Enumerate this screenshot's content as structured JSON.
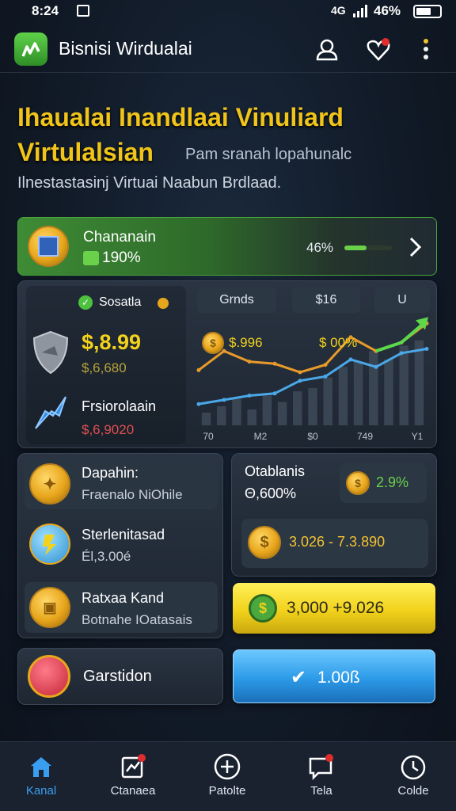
{
  "status_bar": {
    "time": "8:24",
    "battery": "46%"
  },
  "header": {
    "title": "Bisnisi Wirdualai"
  },
  "hero": {
    "line1": "Ihaualai Inandlaai Vinuliard",
    "line2": "Virtulalsian",
    "line2_sub": "Pam sranah lopahunalc",
    "line3": "Ilnestastasinj Virtuai Naabun Brdlaad."
  },
  "banner": {
    "title": "Chananain",
    "rate": "190%",
    "percent": "46%",
    "progress": 0.46
  },
  "stats_card": {
    "badge": "Sosatla",
    "value_main": "$,8.99",
    "value_sub": "$,6,680",
    "item_label": "Frsiorolaain",
    "item_value": "$,6,9020"
  },
  "chart_header": {
    "tab_1": "Grnds",
    "tab_2": "$16",
    "tab_3": "U"
  },
  "chart_labels": {
    "label_1": "$.996",
    "label_2": "$ 00%"
  },
  "chart_data": {
    "type": "line",
    "x_ticks": [
      "70",
      "M2",
      "$0",
      "749",
      "Y1"
    ],
    "series": [
      {
        "values": [
          52,
          70,
          60,
          58,
          50,
          57,
          83,
          70,
          78,
          96
        ]
      },
      {
        "values": [
          20,
          24,
          28,
          30,
          42,
          46,
          62,
          55,
          68,
          72
        ]
      }
    ],
    "bars": [
      12,
      18,
      25,
      15,
      28,
      22,
      32,
      35,
      45,
      55,
      60,
      70,
      62,
      75,
      80
    ],
    "ylim": [
      0,
      100
    ]
  },
  "left_list": [
    {
      "title": "Dapahin:",
      "subtitle": "Fraenalo NiOhile"
    },
    {
      "title": "Sterlenitasad",
      "subtitle": "Él,3.00é"
    },
    {
      "title": "Ratxaa Kand",
      "subtitle": "Botnahe IOatasais"
    }
  ],
  "right_card": {
    "title": "Otablanis",
    "value": "Θ,600%",
    "rate": "2.9%"
  },
  "gold_row": {
    "text": "3.026 - 7.3.890"
  },
  "yellow_button": {
    "label": "3,000 +9.026"
  },
  "bottom_left": {
    "label": "Garstidon"
  },
  "blue_button": {
    "label": "1.00ß"
  },
  "bottom_nav": [
    {
      "label": "Kanal"
    },
    {
      "label": "Ctanaea"
    },
    {
      "label": "Patolte"
    },
    {
      "label": "Tela"
    },
    {
      "label": "Colde"
    }
  ],
  "colors": {
    "accent_green": "#4aa83c",
    "accent_yellow": "#f2d21b",
    "accent_blue": "#2c9ae8",
    "headline_yellow": "#f0c419"
  }
}
